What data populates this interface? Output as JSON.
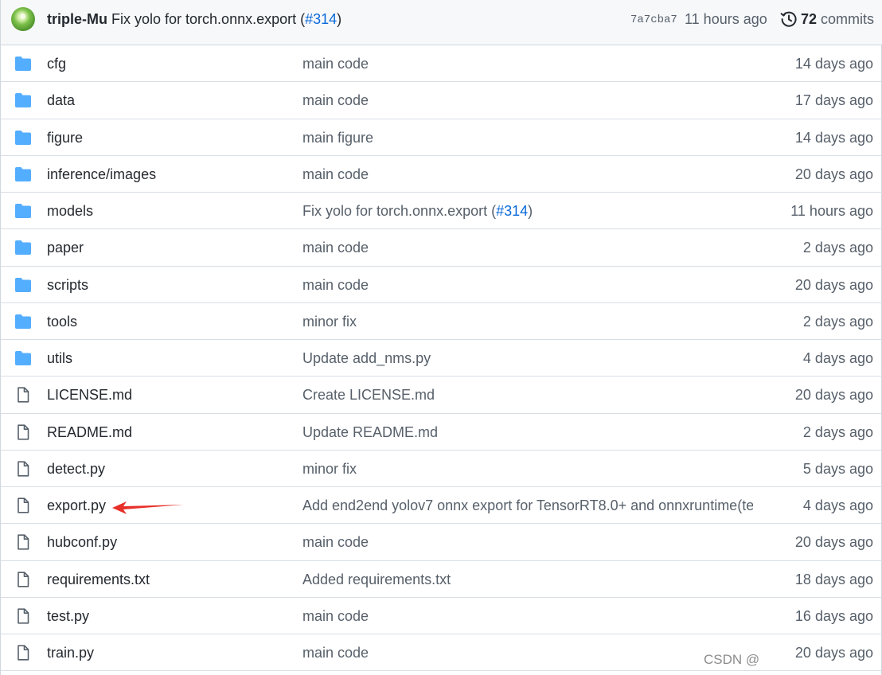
{
  "latest_commit": {
    "author": "triple-Mu",
    "message": "Fix yolo for torch.onnx.export (",
    "pr": "#314",
    "message_end": ")",
    "sha": "7a7cba7",
    "time": "11 hours ago",
    "commits_count": "72",
    "commits_label": "commits",
    "history_icon": "history-clock-icon",
    "avatar_colors": [
      "#7cc04a",
      "#4a8f2a"
    ]
  },
  "files": [
    {
      "type": "folder",
      "name": "cfg",
      "message": "main code",
      "age": "14 days ago"
    },
    {
      "type": "folder",
      "name": "data",
      "message": "main code",
      "age": "17 days ago"
    },
    {
      "type": "folder",
      "name": "figure",
      "message": "main figure",
      "age": "14 days ago"
    },
    {
      "type": "folder",
      "name": "inference/images",
      "message": "main code",
      "age": "20 days ago"
    },
    {
      "type": "folder",
      "name": "models",
      "message": "Fix yolo for torch.onnx.export (",
      "pr": "#314",
      "message_end": ")",
      "age": "11 hours ago"
    },
    {
      "type": "folder",
      "name": "paper",
      "message": "main code",
      "age": "2 days ago"
    },
    {
      "type": "folder",
      "name": "scripts",
      "message": "main code",
      "age": "20 days ago"
    },
    {
      "type": "folder",
      "name": "tools",
      "message": "minor fix",
      "age": "2 days ago"
    },
    {
      "type": "folder",
      "name": "utils",
      "message": "Update add_nms.py",
      "age": "4 days ago"
    },
    {
      "type": "file",
      "name": "LICENSE.md",
      "message": "Create LICENSE.md",
      "age": "20 days ago"
    },
    {
      "type": "file",
      "name": "README.md",
      "message": "Update README.md",
      "age": "2 days ago"
    },
    {
      "type": "file",
      "name": "detect.py",
      "message": "minor fix",
      "age": "5 days ago"
    },
    {
      "type": "file",
      "name": "export.py",
      "message": "Add end2end yolov7 onnx export for TensorRT8.0+ and onnxruntime(te...",
      "age": "4 days ago",
      "annotated": true
    },
    {
      "type": "file",
      "name": "hubconf.py",
      "message": "main code",
      "age": "20 days ago"
    },
    {
      "type": "file",
      "name": "requirements.txt",
      "message": "Added requirements.txt",
      "age": "18 days ago"
    },
    {
      "type": "file",
      "name": "test.py",
      "message": "main code",
      "age": "16 days ago"
    },
    {
      "type": "file",
      "name": "train.py",
      "message": "main code",
      "age": "20 days ago"
    }
  ],
  "icons": {
    "folder": "folder-icon",
    "file": "file-icon"
  },
  "colors": {
    "folder": "#54aeff",
    "link": "#0969da",
    "muted": "#57606a",
    "annotation_arrow": "#e8302a"
  },
  "watermark": "CSDN @"
}
